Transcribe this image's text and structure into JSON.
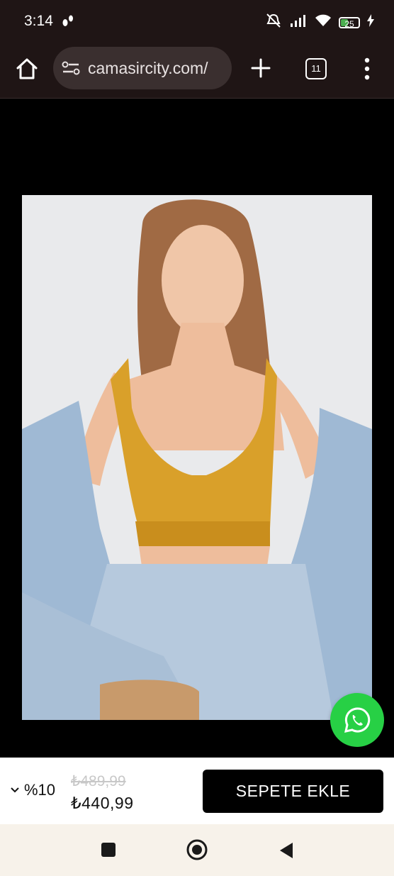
{
  "status_bar": {
    "time": "3:14",
    "battery": "25"
  },
  "browser": {
    "url": "camasircity.com/",
    "tab_count": "11"
  },
  "product": {
    "discount": "%10",
    "old_price": "₺489,99",
    "price": "₺440,99",
    "add_to_cart_label": "SEPETE EKLE"
  },
  "colors": {
    "whatsapp": "#27d045",
    "bra": "#d9a02a",
    "denim": "#9fb9d4"
  },
  "icons": {
    "home": "home-icon",
    "site_settings": "tune-icon",
    "new_tab": "plus-icon",
    "menu": "more-vert-icon",
    "whatsapp": "whatsapp-icon",
    "chevron": "chevron-down-icon"
  }
}
